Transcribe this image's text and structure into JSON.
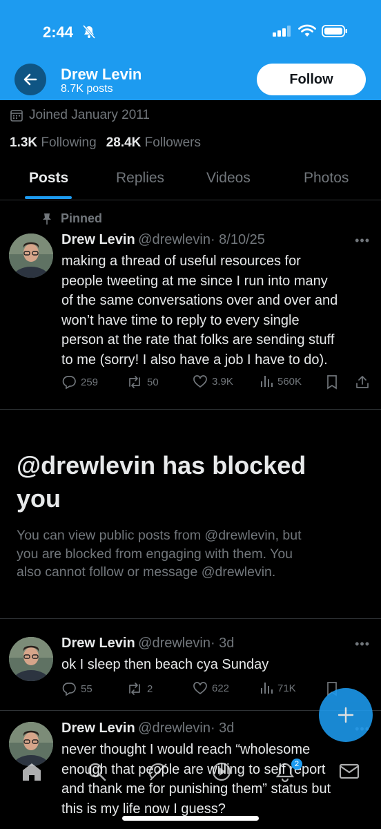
{
  "status_bar": {
    "time": "2:44"
  },
  "header": {
    "name": "Drew Levin",
    "posts": "8.7K posts",
    "follow_label": "Follow"
  },
  "profile": {
    "joined": "Joined January 2011",
    "following_count": "1.3K",
    "following_label": "Following",
    "followers_count": "28.4K",
    "followers_label": "Followers"
  },
  "tabs": [
    {
      "label": "Posts"
    },
    {
      "label": "Replies"
    },
    {
      "label": "Videos"
    },
    {
      "label": "Photos"
    }
  ],
  "pinned_label": "Pinned",
  "tweets": [
    {
      "name": "Drew Levin",
      "handle": "@drewlevin",
      "date": "· 8/10/25",
      "lines": [
        "making a thread of useful resources for",
        "people tweeting at me since I run into many",
        "of the same conversations over and over and",
        "won’t have time to reply to every single",
        "person at the rate that folks are sending stuff",
        "to me (sorry! I also have a job I have to do)."
      ],
      "replies": "259",
      "reposts": "50",
      "likes": "3.9K",
      "views": "560K"
    },
    {
      "name": "Drew Levin",
      "handle": "@drewlevin",
      "date": "· 3d",
      "lines": [
        "ok I sleep then beach cya Sunday"
      ],
      "replies": "55",
      "reposts": "2",
      "likes": "622",
      "views": "71K"
    },
    {
      "name": "Drew Levin",
      "handle": "@drewlevin",
      "date": "· 3d",
      "lines": [
        "never thought I would reach “wholesome",
        "enough that people are willing to self report",
        "and thank me for punishing them” status but",
        "this is my life now I guess?"
      ]
    }
  ],
  "blocked": {
    "title_line1": "@drewlevin has blocked",
    "title_line2": "you",
    "lines": [
      "You can view public posts from @drewlevin, but",
      "you are blocked from engaging with them. You",
      "also cannot follow or message @drewlevin."
    ]
  },
  "notifications_badge": "2",
  "colors": {
    "accent": "#1d9bf0",
    "background": "#000000",
    "muted_text": "#71767b"
  }
}
